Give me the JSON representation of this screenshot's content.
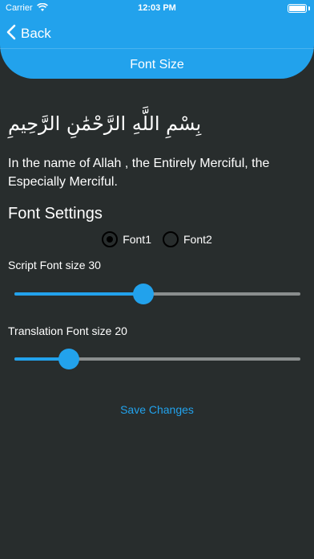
{
  "status_bar": {
    "carrier": "Carrier",
    "time": "12:03 PM"
  },
  "nav": {
    "back_label": "Back"
  },
  "header": {
    "title": "Font Size"
  },
  "content": {
    "arabic_text": "بِسْمِ اللَّهِ الرَّحْمَٰنِ الرَّحِيمِ",
    "translation_text": "In the name of Allah , the Entirely Merciful, the Especially Merciful.",
    "section_title": "Font Settings"
  },
  "font_options": {
    "selected": "Font1",
    "items": [
      {
        "label": "Font1"
      },
      {
        "label": "Font2"
      }
    ]
  },
  "script_slider": {
    "label": "Script Font size 30",
    "value_fraction": 0.45
  },
  "translation_slider": {
    "label": "Translation Font size 20",
    "value_fraction": 0.19
  },
  "save_label": "Save Changes",
  "colors": {
    "accent": "#22a2ec",
    "background": "#282d2d",
    "track": "#8a8e8e"
  }
}
